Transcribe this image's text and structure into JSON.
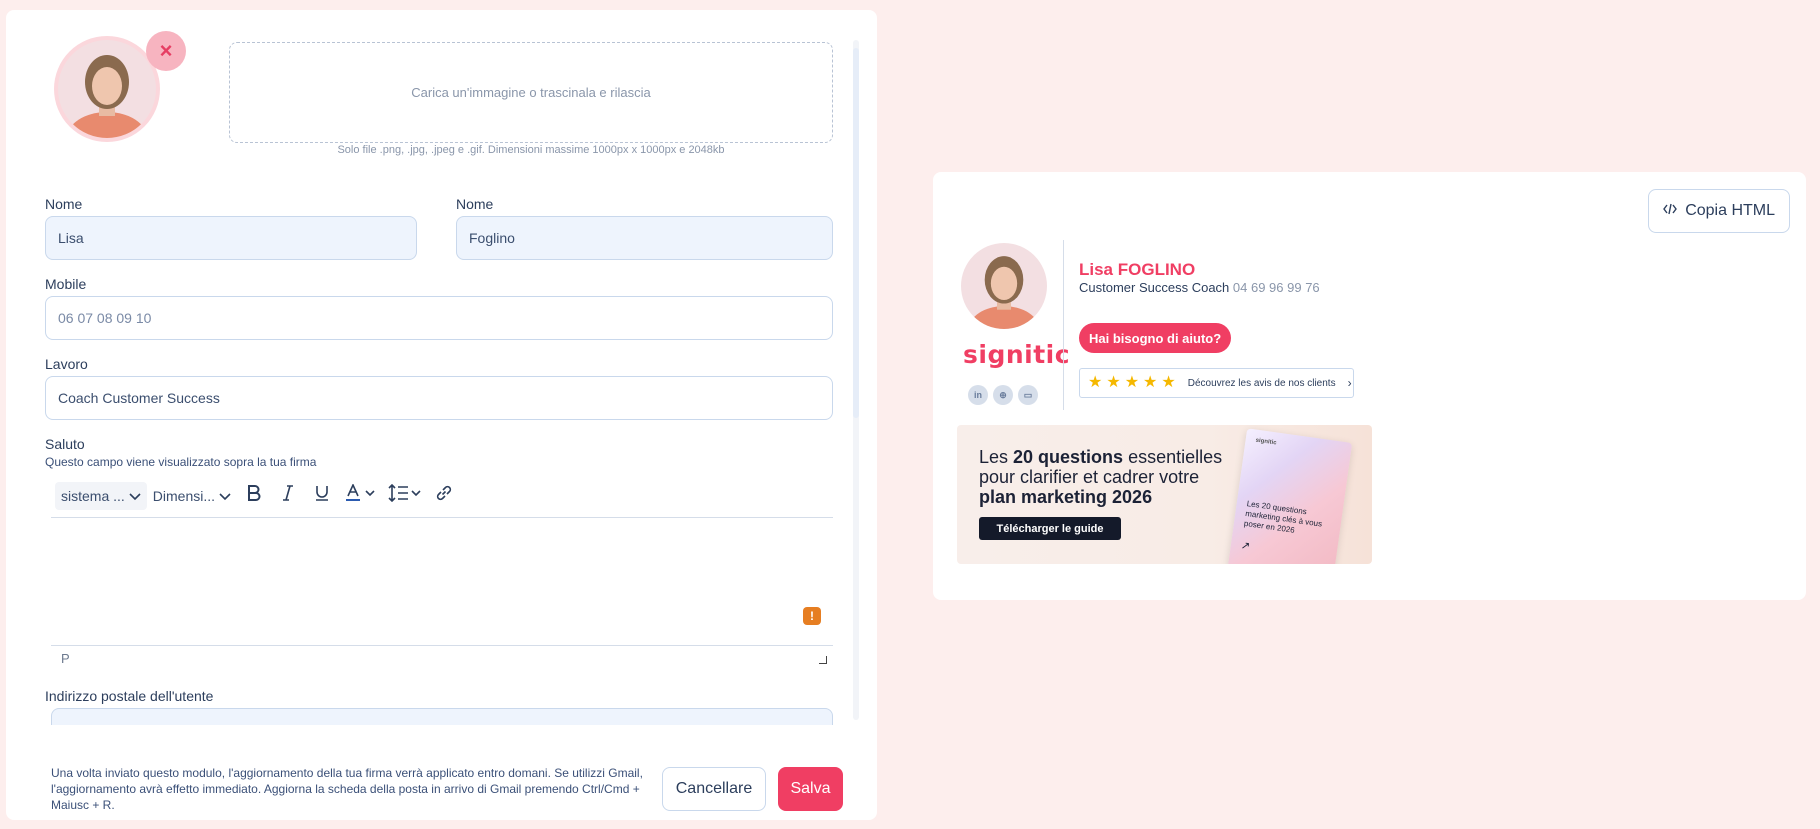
{
  "form": {
    "upload_prompt": "Carica un'immagine o trascinala e rilascia",
    "upload_hint": "Solo file .png, .jpg, .jpeg e .gif. Dimensioni massime 1000px x 1000px e 2048kb",
    "remove_icon": "×",
    "first_name": {
      "label": "Nome",
      "value": "Lisa"
    },
    "last_name": {
      "label": "Nome",
      "value": "Foglino"
    },
    "mobile": {
      "label": "Mobile",
      "value": "06 07 08 09 10"
    },
    "job": {
      "label": "Lavoro",
      "value": "Coach Customer Success"
    },
    "greeting": {
      "label": "Saluto",
      "sublabel": "Questo campo viene visualizzato sopra la tua firma",
      "font_select": "sistema ...",
      "size_select": "Dimensi...",
      "status_path": "P",
      "warning": "!"
    },
    "address": {
      "label": "Indirizzo postale dell'utente"
    }
  },
  "footer": {
    "note": "Una volta inviato questo modulo, l'aggiornamento della tua firma verrà applicato entro domani. Se utilizzi Gmail, l'aggiornamento avrà effetto immediato. Aggiorna la scheda della posta in arrivo di Gmail premendo Ctrl/Cmd + Maiusc + R.",
    "cancel_label": "Cancellare",
    "save_label": "Salva"
  },
  "preview": {
    "copy_label": "Copia HTML",
    "logo": "signitic",
    "name": "Lisa FOGLINO",
    "title": "Customer Success Coach",
    "phone": "04 69 96 99 76",
    "help_label": "Hai bisogno di aiuto?",
    "reviews_label": "Découvrez les avis de nos clients",
    "social": [
      "in",
      "⊕",
      "▭"
    ],
    "banner": {
      "line1_pre": "Les ",
      "line1_bold": "20 questions",
      "line1_post": " essentielles",
      "line2": "pour clarifier et cadrer votre",
      "line3": "plan marketing 2026",
      "cta": "Télécharger le guide",
      "book_logo": "signitic",
      "book_text": "Les 20 questions marketing clés à vous poser en 2026",
      "book_arrow": "↗"
    }
  },
  "colors": {
    "accent": "#f03e63",
    "text": "#2c3e5c",
    "input_bg": "#eef4fd"
  }
}
